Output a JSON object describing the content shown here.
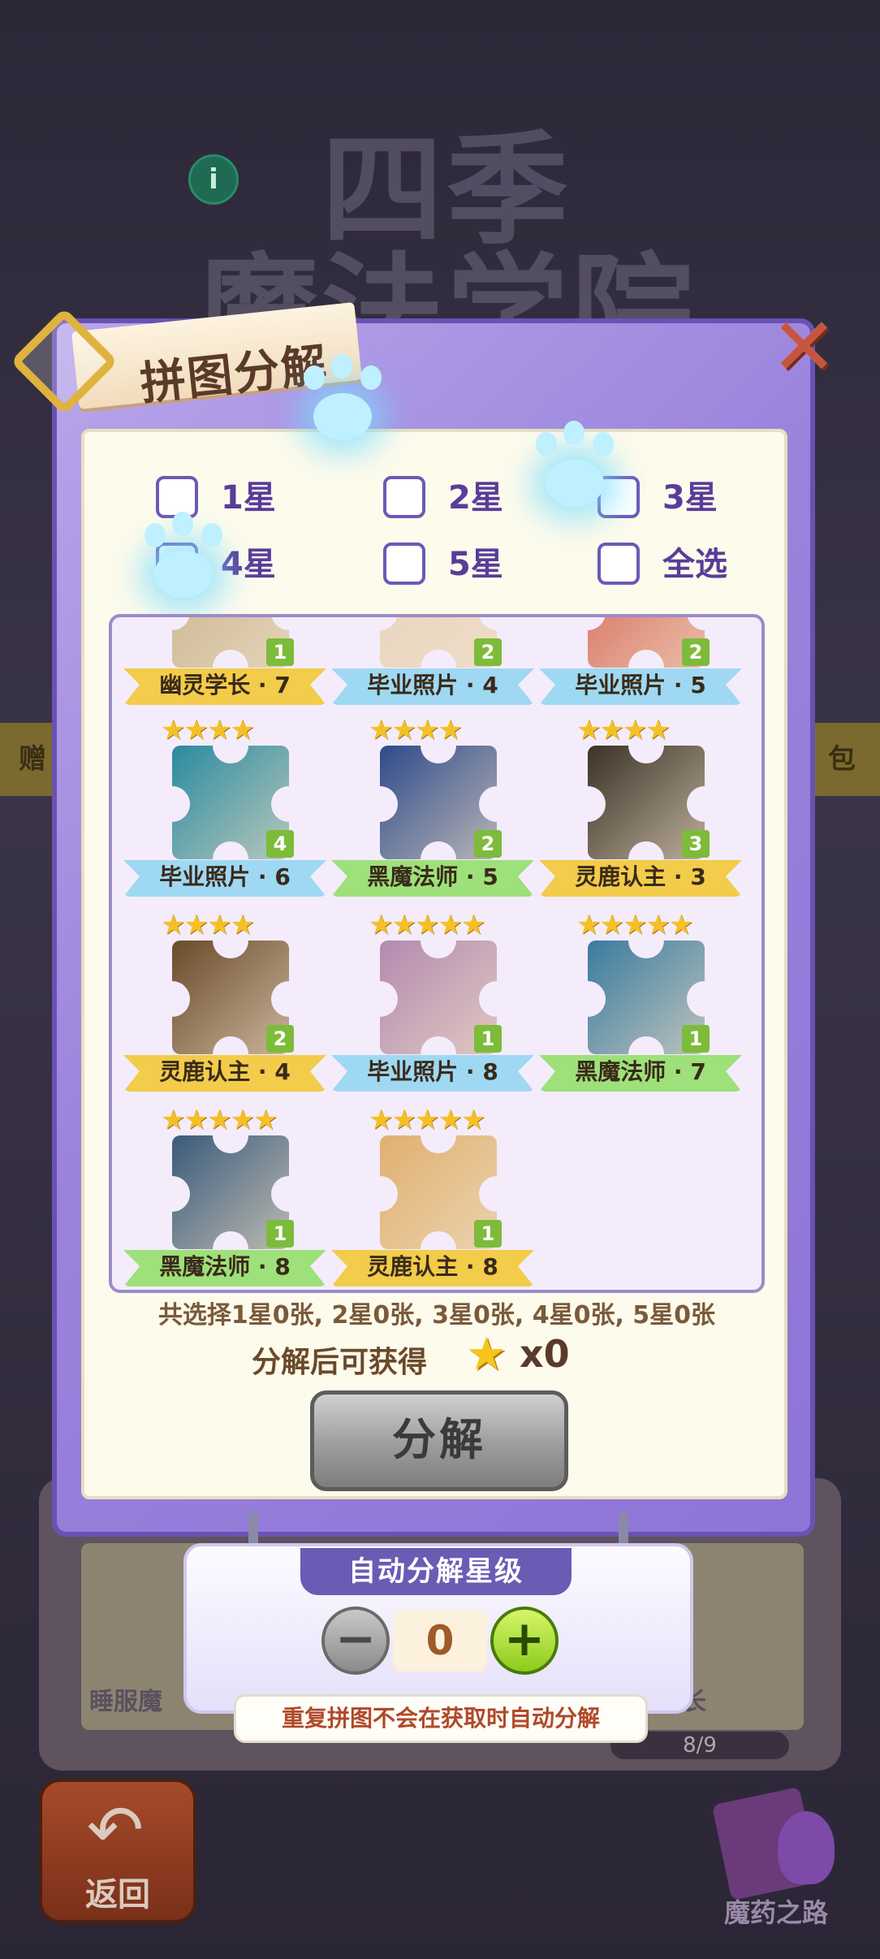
{
  "background": {
    "game_title_lines": [
      "四季",
      "魔法学院"
    ],
    "banner_left": "赠",
    "banner_right": "包",
    "card_left_label": "睡服魔",
    "card_right_label": "长",
    "progress_text": "8/9",
    "back_label": "返回",
    "potion_label": "魔药之路"
  },
  "dialog": {
    "title": "拼图分解",
    "filters": [
      {
        "label": "1星",
        "checked": false
      },
      {
        "label": "2星",
        "checked": false
      },
      {
        "label": "3星",
        "checked": false
      },
      {
        "label": "4星",
        "checked": false
      },
      {
        "label": "5星",
        "checked": false
      },
      {
        "label": "全选",
        "checked": false
      }
    ],
    "pieces": [
      {
        "name": "幽灵学长 · 7",
        "count": "1",
        "stars": "",
        "ribbon": "gold",
        "art": "#c9b490"
      },
      {
        "name": "毕业照片 · 4",
        "count": "2",
        "stars": "",
        "ribbon": "blue",
        "art": "#e8d4c0"
      },
      {
        "name": "毕业照片 · 5",
        "count": "2",
        "stars": "",
        "ribbon": "blue",
        "art": "#d86a5a"
      },
      {
        "name": "毕业照片 · 6",
        "count": "4",
        "stars": "★★★★",
        "ribbon": "blue",
        "art": "#2a8aa0"
      },
      {
        "name": "黑魔法师 · 5",
        "count": "2",
        "stars": "★★★★",
        "ribbon": "green",
        "art": "#2e4a8a"
      },
      {
        "name": "灵鹿认主 · 3",
        "count": "3",
        "stars": "★★★★",
        "ribbon": "gold",
        "art": "#3a3226"
      },
      {
        "name": "灵鹿认主 · 4",
        "count": "2",
        "stars": "★★★★",
        "ribbon": "gold",
        "art": "#6a4a2a"
      },
      {
        "name": "毕业照片 · 8",
        "count": "1",
        "stars": "★★★★★",
        "ribbon": "blue",
        "art": "#b48ab0"
      },
      {
        "name": "黑魔法师 · 7",
        "count": "1",
        "stars": "★★★★★",
        "ribbon": "green",
        "art": "#3a7aa0"
      },
      {
        "name": "黑魔法师 · 8",
        "count": "1",
        "stars": "★★★★★",
        "ribbon": "green",
        "art": "#3a5a7a"
      },
      {
        "name": "灵鹿认主 · 8",
        "count": "1",
        "stars": "★★★★★",
        "ribbon": "gold",
        "art": "#e0b070"
      }
    ],
    "summary": "共选择1星0张, 2星0张, 3星0张, 4星0张, 5星0张",
    "reward_label": "分解后可获得",
    "reward_count": "x0",
    "decompose_button": "分解"
  },
  "auto_panel": {
    "title": "自动分解星级",
    "value": "0",
    "minus": "−",
    "plus": "+",
    "note": "重复拼图不会在获取时自动分解"
  },
  "colors": {
    "dialog_purple": "#9a82dc",
    "ribbon_gold": "#f2cc4a",
    "ribbon_blue": "#9fd8f2",
    "ribbon_green": "#9ee07a",
    "star_yellow": "#f5c024"
  }
}
